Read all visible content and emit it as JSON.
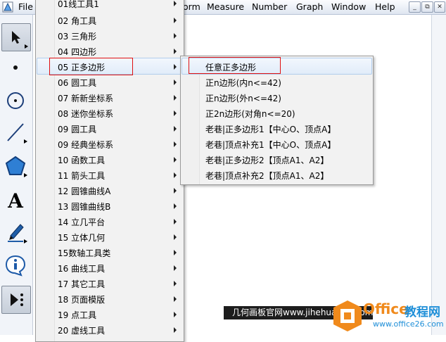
{
  "menubar": {
    "items": [
      "File",
      "orm",
      "Measure",
      "Number",
      "Graph",
      "Window",
      "Help"
    ],
    "window_buttons": [
      "_",
      "⧉",
      "✕"
    ]
  },
  "toolbox": {
    "tools": [
      {
        "name": "arrow-select-tool",
        "icon": "arrow-icon"
      },
      {
        "name": "point-tool",
        "icon": "point-icon"
      },
      {
        "name": "compass-tool",
        "icon": "circle-icon"
      },
      {
        "name": "straightedge-tool",
        "icon": "line-icon"
      },
      {
        "name": "polygon-tool",
        "icon": "polygon-icon"
      },
      {
        "name": "text-tool",
        "icon": "text-icon",
        "glyph": "A"
      },
      {
        "name": "marker-tool",
        "icon": "pencil-icon"
      },
      {
        "name": "information-tool",
        "icon": "info-icon"
      },
      {
        "name": "custom-tools",
        "icon": "custom-tool-icon"
      }
    ]
  },
  "main_menu": {
    "items": [
      "01线工具1",
      "02 角工具",
      "03 三角形",
      "04 四边形",
      "05 正多边形",
      "06 圆工具",
      "07 新新坐标系",
      "08 迷你坐标系",
      "09 圆工具",
      "09 经典坐标系",
      "10 函数工具",
      "11 箭头工具",
      "12 圆锥曲线A",
      "13 圆锥曲线B",
      "14 立几平台",
      "15 立体几何",
      "15数轴工具类",
      "16 曲线工具",
      "17 其它工具",
      "18 页面模版",
      "19 点工具",
      "20 虚线工具"
    ],
    "highlighted_index": 4
  },
  "submenu": {
    "items": [
      "任意正多边形",
      "正n边形(内n<=42)",
      "正n边形(外n<=42)",
      "正2n边形(对角n<=20)",
      "老巷|正多边形1【中心O、顶点A】",
      "老巷|顶点补充1【中心O、顶点A】",
      "老巷|正多边形2【顶点A1、A2】",
      "老巷|顶点补充2【顶点A1、A2】"
    ],
    "highlighted_index": 0
  },
  "watermark": {
    "banner_text": "几何画板官网www.jihehuaban.com.cn",
    "logo_word1": "Office",
    "logo_word2": "教程网",
    "logo_url": "www.office26.com"
  },
  "colors": {
    "highlight_border": "#e01010",
    "logo_orange": "#f08a1c",
    "logo_blue": "#1f8fd8"
  }
}
